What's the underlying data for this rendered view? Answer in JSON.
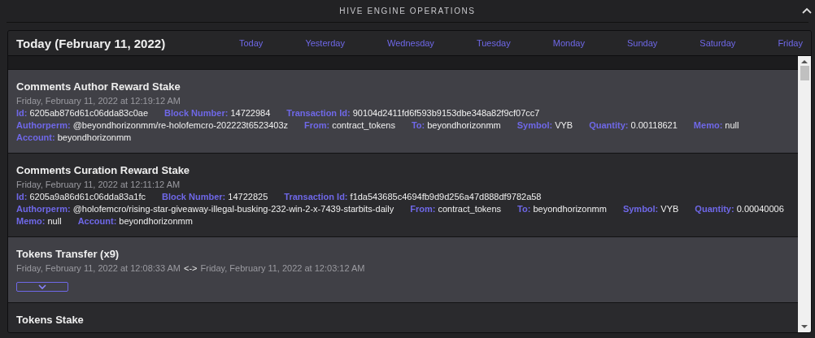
{
  "header": {
    "title": "HIVE ENGINE OPERATIONS",
    "collapsed": false
  },
  "panel": {
    "title": "Today (February 11, 2022)",
    "tabs": [
      {
        "label": "Today",
        "selected": false
      },
      {
        "label": "Yesterday",
        "selected": false
      },
      {
        "label": "Wednesday",
        "selected": false
      },
      {
        "label": "Tuesday",
        "selected": false
      },
      {
        "label": "Monday",
        "selected": false
      },
      {
        "label": "Sunday",
        "selected": false
      },
      {
        "label": "Saturday",
        "selected": false
      },
      {
        "label": "Friday",
        "selected": false
      }
    ],
    "operations": [
      {
        "kind": "single",
        "title": "Comments Author Reward Stake",
        "date": "Friday, February 11, 2022 at 12:19:12 AM",
        "lines": [
          [
            {
              "label": "Id:",
              "value": "6205ab876d61c06dda83c0ae"
            },
            {
              "label": "Block Number:",
              "value": "14722984"
            },
            {
              "label": "Transaction Id:",
              "value": "90104d2411fd6f593b9153dbe348a82f9cf07cc7"
            }
          ],
          [
            {
              "label": "Authorperm:",
              "value": "@beyondhorizonmm/re-holofemcro-202223t6523403z"
            },
            {
              "label": "From:",
              "value": "contract_tokens"
            },
            {
              "label": "To:",
              "value": "beyondhorizonmm"
            },
            {
              "label": "Symbol:",
              "value": "VYB"
            },
            {
              "label": "Quantity:",
              "value": "0.00118621"
            },
            {
              "label": "Memo:",
              "value": "null"
            }
          ],
          [
            {
              "label": "Account:",
              "value": "beyondhorizonmm"
            }
          ]
        ]
      },
      {
        "kind": "single",
        "title": "Comments Curation Reward Stake",
        "date": "Friday, February 11, 2022 at 12:11:12 AM",
        "lines": [
          [
            {
              "label": "Id:",
              "value": "6205a9a86d61c06dda83a1fc"
            },
            {
              "label": "Block Number:",
              "value": "14722825"
            },
            {
              "label": "Transaction Id:",
              "value": "f1da543685c4694fb9d9d256a47d888df9782a58"
            }
          ],
          [
            {
              "label": "Authorperm:",
              "value": "@holofemcro/rising-star-giveaway-illegal-busking-232-win-2-x-7439-starbits-daily"
            },
            {
              "label": "From:",
              "value": "contract_tokens"
            },
            {
              "label": "To:",
              "value": "beyondhorizonmm"
            },
            {
              "label": "Symbol:",
              "value": "VYB"
            },
            {
              "label": "Quantity:",
              "value": "0.00040006"
            }
          ],
          [
            {
              "label": "Memo:",
              "value": "null"
            },
            {
              "label": "Account:",
              "value": "beyondhorizonmm"
            }
          ]
        ]
      },
      {
        "kind": "group",
        "title": "Tokens Transfer (x9)",
        "date_start": "Friday, February 11, 2022 at 12:08:33 AM",
        "separator": "<->",
        "date_end": "Friday, February 11, 2022 at 12:03:12 AM",
        "expanded": false
      },
      {
        "kind": "single",
        "title": "Tokens Stake"
      }
    ]
  }
}
